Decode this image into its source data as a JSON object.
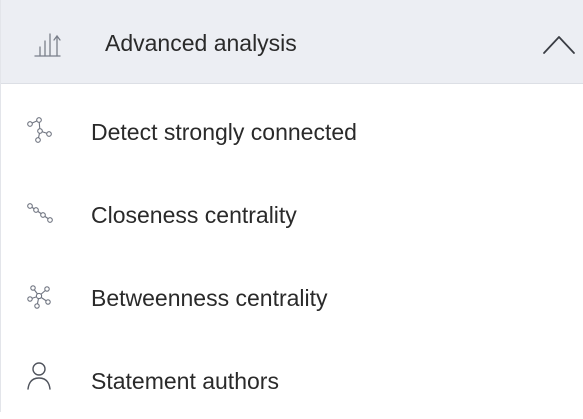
{
  "section": {
    "title": "Advanced analysis",
    "icon": "bar-chart-up-icon",
    "expanded": true,
    "toggle_icon": "chevron-up-icon"
  },
  "items": [
    {
      "label": "Detect strongly connected",
      "icon": "connected-nodes-icon"
    },
    {
      "label": "Closeness centrality",
      "icon": "node-chain-icon"
    },
    {
      "label": "Betweenness centrality",
      "icon": "hub-nodes-icon"
    },
    {
      "label": "Statement authors",
      "icon": "person-icon"
    }
  ],
  "colors": {
    "header_bg": "#eceef3",
    "text": "#2a2a2a",
    "icon_stroke": "#6f7480"
  }
}
